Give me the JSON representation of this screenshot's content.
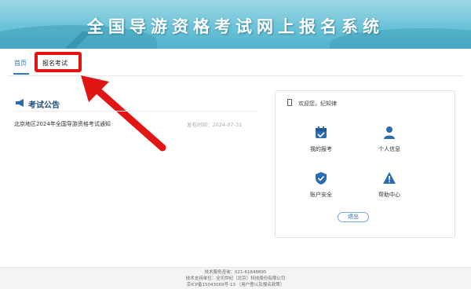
{
  "banner": {
    "title": "全国导游资格考试网上报名系统"
  },
  "nav": {
    "tabs": [
      "首页",
      "报名考试"
    ]
  },
  "announcement": {
    "title": "考试公告",
    "items": [
      {
        "title": "北京地区2024年全国导游资格考试通知",
        "date": "发布时间：2024-07-31"
      }
    ]
  },
  "panel": {
    "welcome": "欢迎您，纪知律",
    "menu": [
      {
        "label": "我的报考",
        "icon": "calendar-check-icon"
      },
      {
        "label": "个人信息",
        "icon": "user-icon"
      },
      {
        "label": "账户安全",
        "icon": "shield-check-icon"
      },
      {
        "label": "帮助中心",
        "icon": "warning-icon"
      }
    ],
    "logout": "退出"
  },
  "footer": {
    "line1": "技术服务咨询：021-61848895",
    "line2": "技术支持单位：全讯世纪（北京）科技股份有限公司",
    "line3": "京ICP备15043069号-13  （用户登以及报名政策）"
  },
  "colors": {
    "accent": "#2b7bc6",
    "highlight": "#e21515",
    "banner": "#6cc3d8"
  }
}
